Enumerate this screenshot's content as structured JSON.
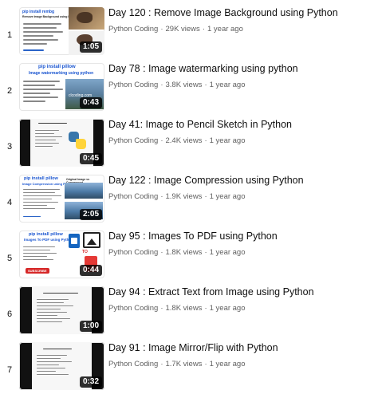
{
  "videos": [
    {
      "index": "1",
      "title": "Day 120 : Remove Image Background using Python",
      "channel": "Python Coding",
      "views": "29K views",
      "age": "1 year ago",
      "duration": "1:05"
    },
    {
      "index": "2",
      "title": "Day 78 : Image watermarking using python",
      "channel": "Python Coding",
      "views": "3.8K views",
      "age": "1 year ago",
      "duration": "0:43"
    },
    {
      "index": "3",
      "title": "Day 41: Image to Pencil Sketch in Python",
      "channel": "Python Coding",
      "views": "2.4K views",
      "age": "1 year ago",
      "duration": "0:45"
    },
    {
      "index": "4",
      "title": "Day 122 : Image Compression using Python",
      "channel": "Python Coding",
      "views": "1.9K views",
      "age": "1 year ago",
      "duration": "2:05"
    },
    {
      "index": "5",
      "title": "Day 95 : Images To PDF using Python",
      "channel": "Python Coding",
      "views": "1.8K views",
      "age": "1 year ago",
      "duration": "0:44"
    },
    {
      "index": "6",
      "title": "Day 94 : Extract Text from Image using Python",
      "channel": "Python Coding",
      "views": "1.8K views",
      "age": "1 year ago",
      "duration": "1:00"
    },
    {
      "index": "7",
      "title": "Day 91 : Image Mirror/Flip with Python",
      "channel": "Python Coding",
      "views": "1.7K views",
      "age": "1 year ago",
      "duration": "0:32"
    }
  ],
  "thumbs": {
    "t1_head": "pip install rembg",
    "t1_sub": "Remove Image Background using Python",
    "t2_head": "pip install pillow",
    "t2_sub": "Image watermarking using python",
    "t2_wm": "clcoding.com",
    "t4_head": "pip install pillow",
    "t4_sub": "Image Compression using Python",
    "t4_label": "Original Image vs Compressed",
    "t5_head": "pip install pillow",
    "t5_sub": "Images To PDF using Python",
    "t5_to": "TO",
    "t5_subscribe": "SUBSCRIBE"
  }
}
